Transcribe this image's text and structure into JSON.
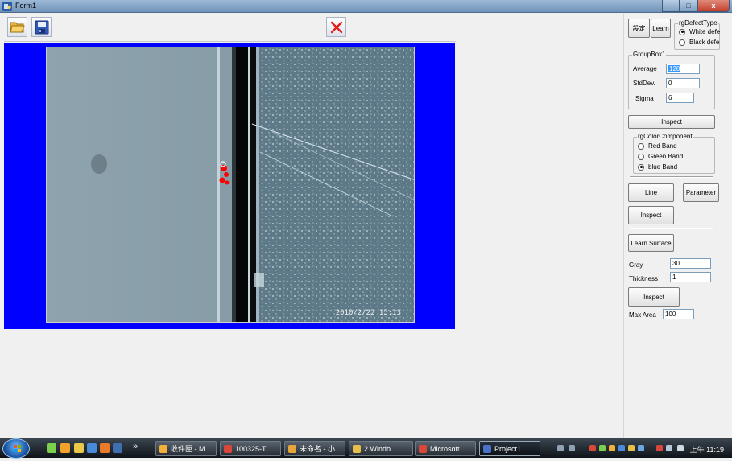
{
  "window": {
    "title": "Form1",
    "min": "─",
    "max": "□",
    "close": "x"
  },
  "toolbar": {
    "open_icon": "folder-open-icon",
    "save_icon": "save-disk-icon",
    "close_icon": "red-x-icon"
  },
  "image": {
    "timestamp": "2010/2/22 15:13"
  },
  "panel": {
    "settings_label": "設定",
    "learn_label": "Learn",
    "defect_type": {
      "legend": "rgDefectType",
      "options": [
        "White defe",
        "Black defe"
      ],
      "selected": 0
    },
    "groupbox1": {
      "legend": "GroupBox1",
      "average_label": "Average",
      "average_value": "128",
      "stddev_label": "StdDev.",
      "stddev_value": "0",
      "sigma_label": "Sigma",
      "sigma_value": "6"
    },
    "inspect1_label": "Inspect",
    "color_component": {
      "legend": "rgColorComponent",
      "options": [
        "Red Band",
        "Green Band",
        "blue Band"
      ],
      "selected": 2
    },
    "line_label": "Line",
    "parameter_label": "Parameter",
    "inspect2_label": "Inspect",
    "learn_surface_label": "Learn Surface",
    "gray_label": "Gray",
    "gray_value": "30",
    "thickness_label": "Thickness",
    "thickness_value": "1",
    "inspect3_label": "Inspect",
    "max_area_label": "Max Area",
    "max_area_value": "100"
  },
  "taskbar": {
    "chevron": "»",
    "tasks": [
      "收件匣 - M...",
      "100325-T...",
      "未命名 - 小...",
      "2 Windo...",
      "Microsoft ...",
      "Project1"
    ],
    "clock": "上午 11:19"
  },
  "colors": {
    "canvas_bg": "#0000ff",
    "accent_red": "#ff0000"
  }
}
